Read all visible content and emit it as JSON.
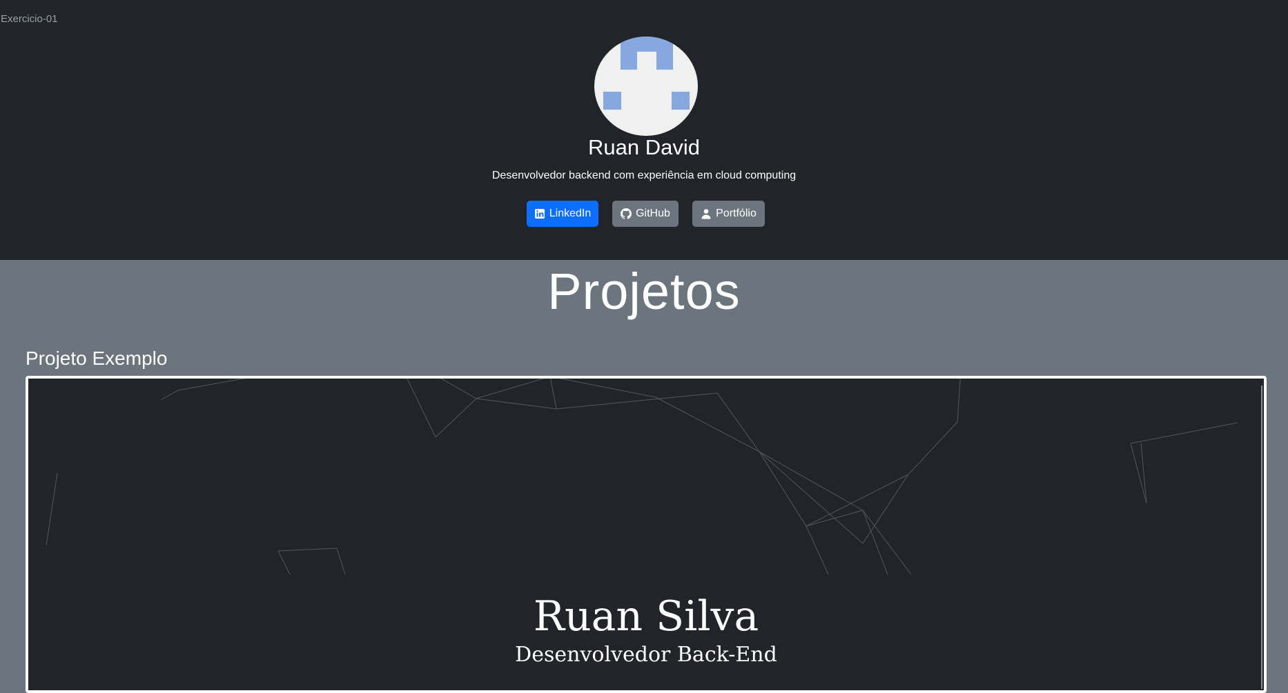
{
  "window": {
    "title": "Exercicio-01"
  },
  "profile": {
    "name": "Ruan David",
    "bio": "Desenvolvedor backend com experiência em cloud computing"
  },
  "links": {
    "linkedin": "LinkedIn",
    "github": "GitHub",
    "portfolio": "Portfólio"
  },
  "icons": {
    "linkedin": "linkedin-icon",
    "github": "github-icon",
    "portfolio": "person-icon"
  },
  "colors": {
    "header_bg": "#212529",
    "page_bg": "#6c757d",
    "primary": "#0d6efd",
    "secondary": "#6c757d"
  },
  "projects_section": {
    "title": "Projetos",
    "items": [
      {
        "title": "Projeto Exemplo",
        "preview": {
          "name": "Ruan Silva",
          "role": "Desenvolvedor Back-End"
        }
      }
    ]
  }
}
